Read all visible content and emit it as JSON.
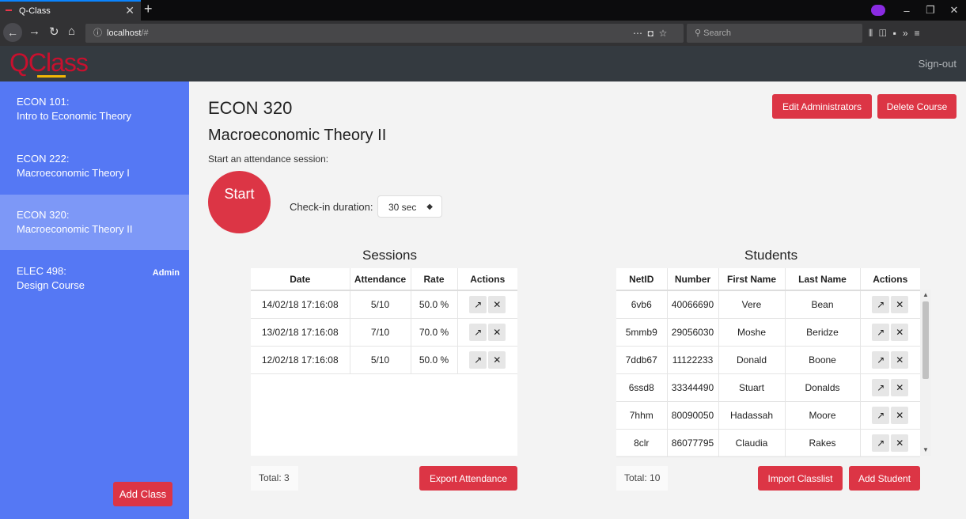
{
  "browser": {
    "tab_title": "Q-Class",
    "url": "localhost",
    "url_suffix": "/#",
    "search_placeholder": "Search"
  },
  "header": {
    "logo": "QClass",
    "signout": "Sign-out"
  },
  "sidebar": {
    "courses": [
      {
        "code": "ECON 101:",
        "name": "Intro to Economic Theory",
        "badge": ""
      },
      {
        "code": "ECON 222:",
        "name": "Macroeconomic Theory I",
        "badge": ""
      },
      {
        "code": "ECON 320:",
        "name": "Macroeconomic Theory II",
        "badge": ""
      },
      {
        "code": "ELEC 498:",
        "name": "Design Course",
        "badge": "Admin"
      }
    ],
    "active_index": 2,
    "add_class": "Add Class"
  },
  "course": {
    "code": "ECON 320",
    "name": "Macroeconomic Theory II",
    "start_label": "Start an attendance session:",
    "start_button": "Start",
    "checkin_label": "Check-in duration:",
    "duration": "30 sec",
    "edit_admins": "Edit Administrators",
    "delete_course": "Delete Course"
  },
  "sessions": {
    "title": "Sessions",
    "headers": [
      "Date",
      "Attendance",
      "Rate",
      "Actions"
    ],
    "rows": [
      [
        "14/02/18 17:16:08",
        "5/10",
        "50.0 %"
      ],
      [
        "13/02/18 17:16:08",
        "7/10",
        "70.0 %"
      ],
      [
        "12/02/18 17:16:08",
        "5/10",
        "50.0 %"
      ]
    ],
    "total": "Total: 3",
    "export": "Export Attendance"
  },
  "students": {
    "title": "Students",
    "headers": [
      "NetID",
      "Number",
      "First Name",
      "Last Name",
      "Actions"
    ],
    "rows": [
      [
        "6vb6",
        "40066690",
        "Vere",
        "Bean"
      ],
      [
        "5mmb9",
        "29056030",
        "Moshe",
        "Beridze"
      ],
      [
        "7ddb67",
        "11122233",
        "Donald",
        "Boone"
      ],
      [
        "6ssd8",
        "33344490",
        "Stuart",
        "Donalds"
      ],
      [
        "7hhm",
        "80090050",
        "Hadassah",
        "Moore"
      ],
      [
        "8clr",
        "86077795",
        "Claudia",
        "Rakes"
      ]
    ],
    "total": "Total: 10",
    "import": "Import Classlist",
    "add": "Add Student"
  },
  "icons": {
    "open": "↗",
    "remove": "✕"
  }
}
